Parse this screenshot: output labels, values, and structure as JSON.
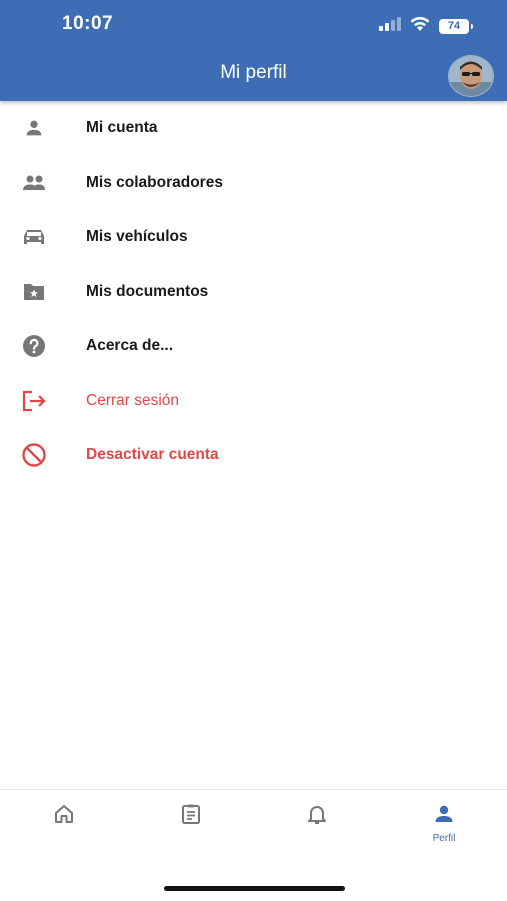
{
  "status_bar": {
    "time": "10:07",
    "battery": "74"
  },
  "header": {
    "title": "Mi perfil"
  },
  "menu": {
    "items": [
      {
        "label": "Mi cuenta",
        "icon": "person-icon"
      },
      {
        "label": "Mis colaboradores",
        "icon": "people-icon"
      },
      {
        "label": "Mis vehículos",
        "icon": "car-icon"
      },
      {
        "label": "Mis documentos",
        "icon": "star-folder-icon"
      },
      {
        "label": "Acerca de...",
        "icon": "help-icon"
      },
      {
        "label": "Cerrar sesión",
        "icon": "logout-icon",
        "color": "#e04848"
      },
      {
        "label": "Desactivar cuenta",
        "icon": "block-icon",
        "color": "#e04848"
      }
    ]
  },
  "bottom_nav": {
    "tabs": [
      {
        "icon": "home-icon",
        "label": ""
      },
      {
        "icon": "clipboard-icon",
        "label": ""
      },
      {
        "icon": "bell-icon",
        "label": ""
      },
      {
        "icon": "person-icon",
        "label": "Perfil",
        "active": true
      }
    ]
  },
  "colors": {
    "primary": "#3d6db5",
    "danger": "#e04848",
    "icon_gray": "#777777"
  }
}
